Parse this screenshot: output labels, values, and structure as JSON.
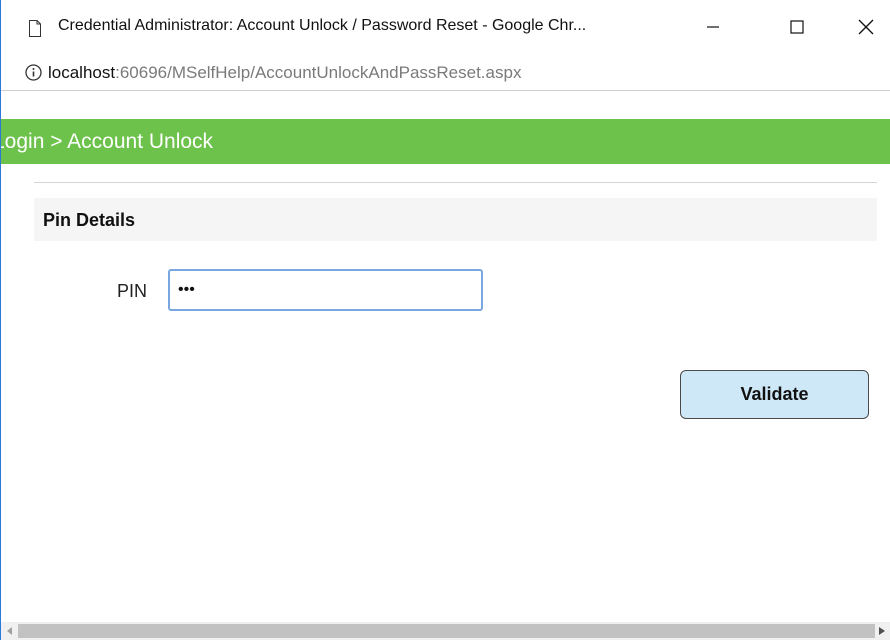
{
  "window": {
    "title": "Credential Administrator: Account Unlock / Password Reset - Google Chr...",
    "controls": {
      "minimize_icon": "minimize-icon",
      "maximize_icon": "maximize-icon",
      "close_icon": "close-icon"
    }
  },
  "address_bar": {
    "info_icon": "info-icon",
    "host": "localhost",
    "path": ":60696/MSelfHelp/AccountUnlockAndPassReset.aspx"
  },
  "header": {
    "breadcrumb": "Login > Account Unlock",
    "color": "#6cc24a"
  },
  "section": {
    "title": "Pin Details"
  },
  "form": {
    "pin_label": "PIN",
    "pin_value": "•••"
  },
  "actions": {
    "validate_label": "Validate",
    "validate_color": "#cfe8f7"
  }
}
